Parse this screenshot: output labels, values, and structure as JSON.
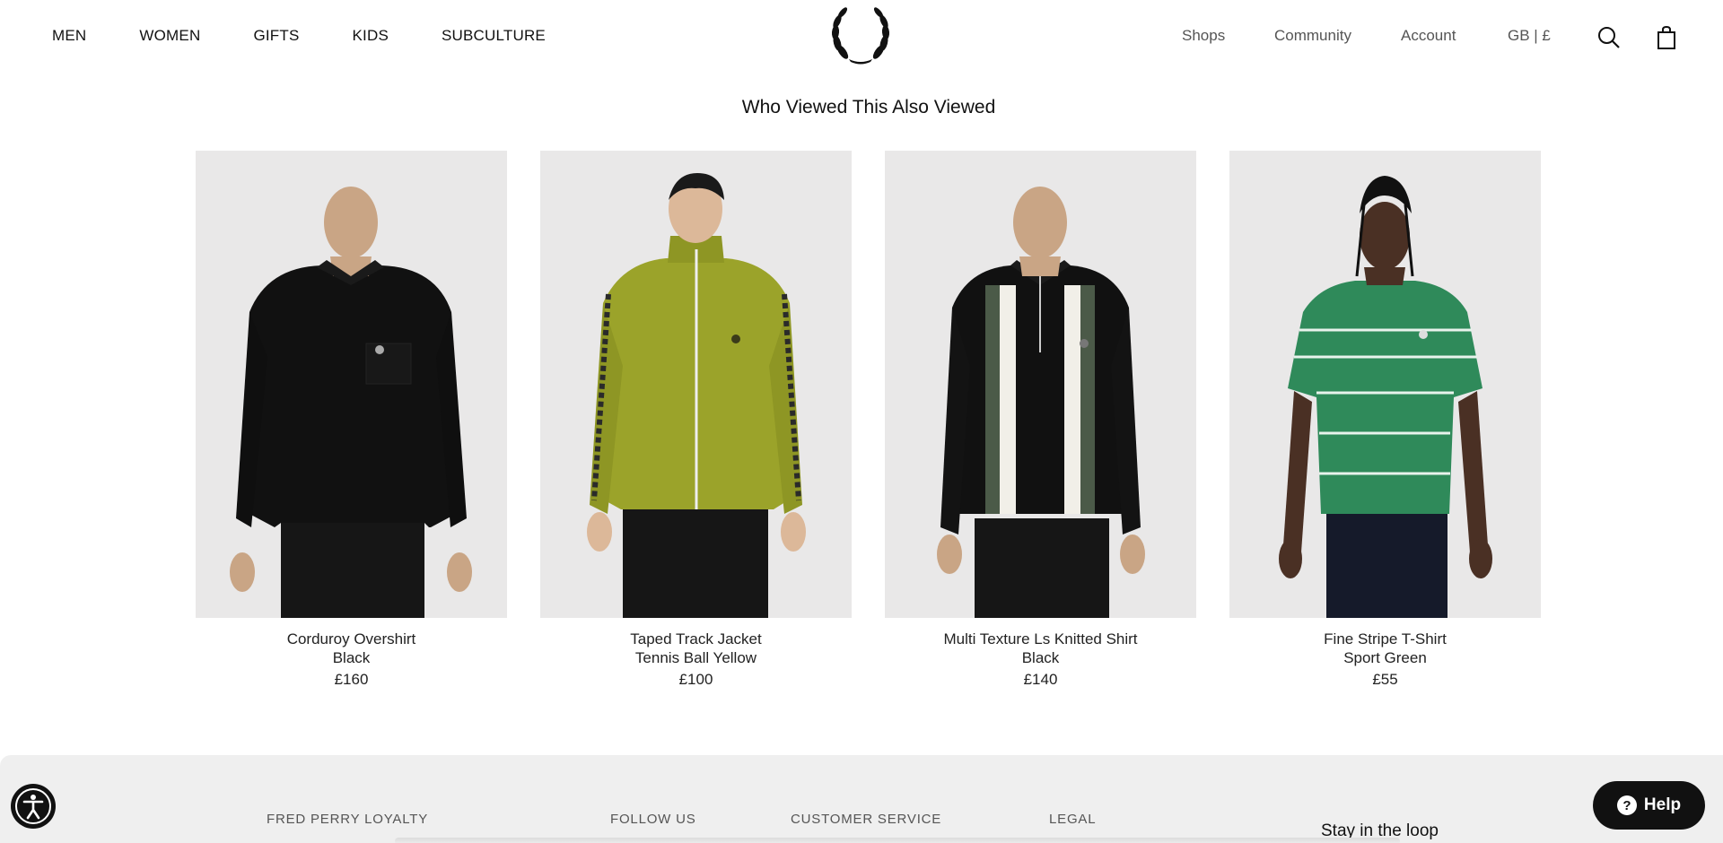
{
  "header": {
    "nav_left": [
      "MEN",
      "WOMEN",
      "GIFTS",
      "KIDS",
      "SUBCULTURE"
    ],
    "nav_right": {
      "shops": "Shops",
      "community": "Community",
      "account": "Account",
      "locale": "GB | £"
    }
  },
  "section": {
    "title": "Who Viewed This Also Viewed"
  },
  "products": [
    {
      "name": "Corduroy Overshirt",
      "color": "Black",
      "price": "£160"
    },
    {
      "name": "Taped Track Jacket",
      "color": "Tennis Ball Yellow",
      "price": "£100"
    },
    {
      "name": "Multi Texture Ls Knitted Shirt",
      "color": "Black",
      "price": "£140"
    },
    {
      "name": "Fine Stripe T-Shirt",
      "color": "Sport Green",
      "price": "£55"
    }
  ],
  "footer": {
    "loyalty": "FRED PERRY LOYALTY",
    "follow": "FOLLOW US",
    "customer_service": "CUSTOMER SERVICE",
    "legal": "LEGAL",
    "newsletter": "Stay in the loop"
  },
  "help": {
    "label": "Help"
  },
  "icons": [
    "laurel-logo-icon",
    "search-icon",
    "bag-icon",
    "accessibility-icon",
    "question-icon"
  ]
}
